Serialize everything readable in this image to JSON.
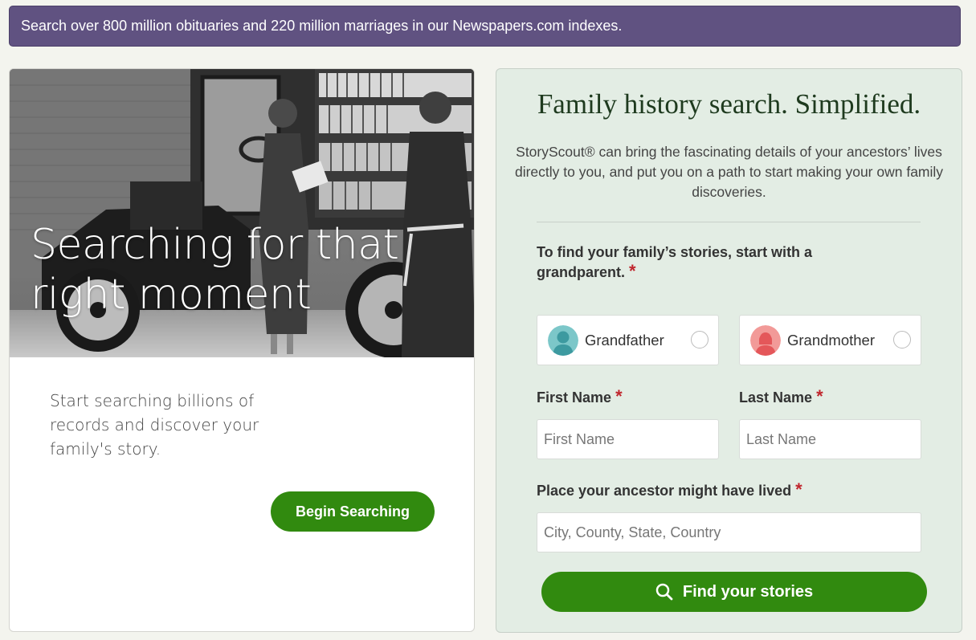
{
  "banner": {
    "text": "Search over 800 million obituaries and 220 million marriages in our Newspapers.com indexes."
  },
  "left_card": {
    "hero_title": "Searching for that right moment",
    "description": "Start searching billions of records and discover your family's story.",
    "button_label": "Begin Searching"
  },
  "right_card": {
    "title": "Family history search. Simplified.",
    "description": "StoryScout® can bring the fascinating details of your ancestors’ lives directly to you, and put you on a path to start making your own family discoveries.",
    "prompt": "To find your family’s stories, start with a grandparent.",
    "required_mark": "*",
    "grandparents": [
      {
        "label": "Grandfather",
        "avatar_color": "#7cc7c9",
        "figure_color": "#3d9aa0"
      },
      {
        "label": "Grandmother",
        "avatar_color": "#f29a98",
        "figure_color": "#e4575a"
      }
    ],
    "first_name": {
      "label": "First Name",
      "placeholder": "First Name",
      "value": ""
    },
    "last_name": {
      "label": "Last Name",
      "placeholder": "Last Name",
      "value": ""
    },
    "place": {
      "label": "Place your ancestor might have lived",
      "placeholder": "City, County, State, Country",
      "value": ""
    },
    "find_button_label": "Find your stories"
  },
  "colors": {
    "banner_bg": "#605281",
    "button_green": "#318a0f",
    "form_bg": "#e3ede4",
    "required_red": "#c0262d",
    "page_bg": "#f3f4ee"
  }
}
